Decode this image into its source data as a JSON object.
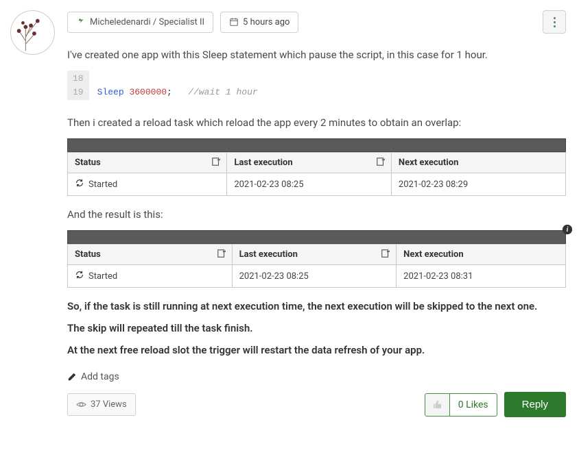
{
  "author": {
    "name": "Micheledenardi",
    "rank": "Specialist II"
  },
  "posted": "5 hours ago",
  "paragraphs": {
    "p1": "I've created one app with this Sleep statement which pause the script, in this case for 1 hour.",
    "p2": "Then i created a reload task which reload the app every 2 minutes to obtain an overlap:",
    "p3": "And the result is this:",
    "p4": "So, if the task is still running at next execution time, the next execution will be skipped to the next one.",
    "p5": "The skip will repeated till the task finish.",
    "p6": "At the next free reload slot the trigger will restart the data refresh of your app."
  },
  "code": {
    "line_prev": "18",
    "line": "19",
    "kw": "Sleep",
    "num": "3600000",
    "punct": ";",
    "comment": "//wait 1 hour"
  },
  "table_headers": {
    "status": "Status",
    "last": "Last execution",
    "next": "Next execution"
  },
  "table1": {
    "status": "Started",
    "last": "2021-02-23 08:25",
    "next": "2021-02-23 08:29"
  },
  "table2": {
    "status": "Started",
    "last": "2021-02-23 08:25",
    "next": "2021-02-23 08:31"
  },
  "tags_label": "Add tags",
  "views": "37 Views",
  "likes": "0 Likes",
  "reply": "Reply"
}
